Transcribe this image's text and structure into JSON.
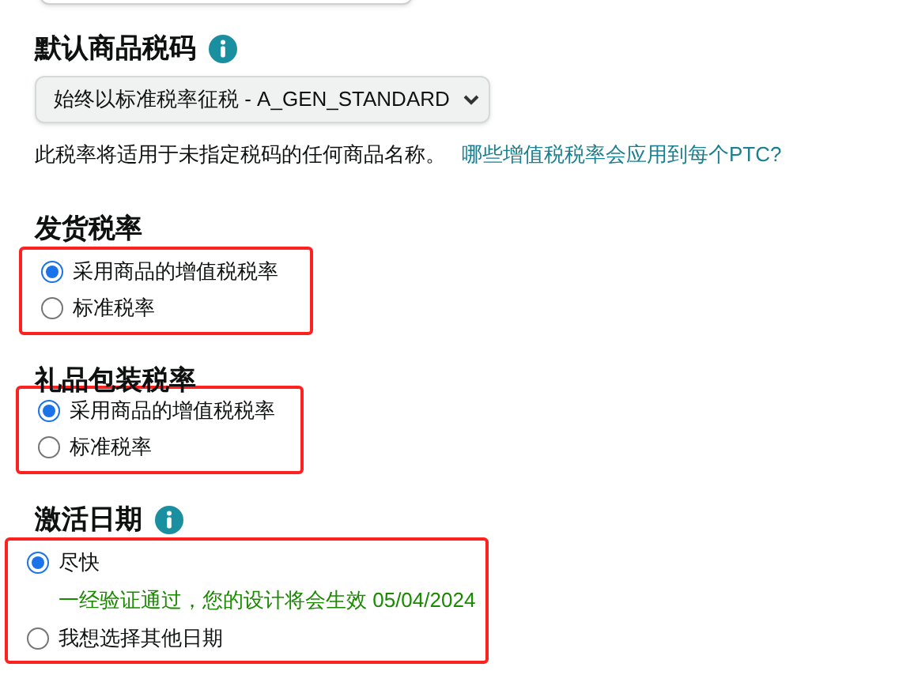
{
  "tax_code": {
    "heading": "默认商品税码",
    "info": true,
    "select": {
      "value": "始终以标准税率征税 - A_GEN_STANDARD"
    },
    "help_text": "此税率将适用于未指定税码的任何商品名称。",
    "help_link": "哪些增值税税率会应用到每个PTC?"
  },
  "groups": [
    {
      "heading": "发货税率",
      "info": false,
      "highlighted": true,
      "options": [
        {
          "label": "采用商品的增值税税率",
          "selected": true
        },
        {
          "label": "标准税率",
          "selected": false
        }
      ]
    },
    {
      "heading": "礼品包装税率",
      "info": false,
      "highlighted": true,
      "options": [
        {
          "label": "采用商品的增值税税率",
          "selected": true
        },
        {
          "label": "标准税率",
          "selected": false
        }
      ]
    },
    {
      "heading": "激活日期",
      "info": true,
      "highlighted": true,
      "options": [
        {
          "label": "尽快",
          "selected": true,
          "note": "一经验证通过，您的设计将会生效 05/04/2024"
        },
        {
          "label": "我想选择其他日期",
          "selected": false
        }
      ]
    }
  ]
}
